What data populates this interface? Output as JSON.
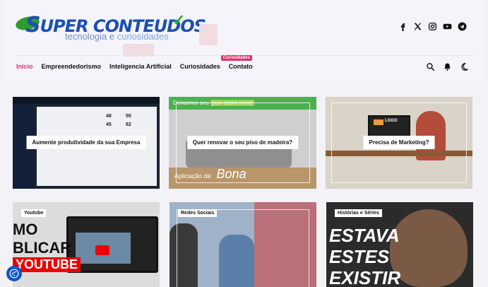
{
  "logo": {
    "main_text": "UPER CONTEUDOS",
    "s_letter": "S",
    "sub_text": "tecnologia e ",
    "sub_accent": "curiosidades"
  },
  "socials": [
    {
      "icon": "facebook-icon"
    },
    {
      "icon": "x-icon"
    },
    {
      "icon": "instagram-icon"
    },
    {
      "icon": "youtube-icon"
    },
    {
      "icon": "telegram-icon"
    }
  ],
  "nav": {
    "items": [
      {
        "label": "Início",
        "active": true
      },
      {
        "label": "Empreendedorismo"
      },
      {
        "label": "Inteligencia Artificial"
      },
      {
        "label": "Curiosidades"
      },
      {
        "label": "Contato"
      }
    ],
    "badge": "Curiosidades"
  },
  "tools": [
    "search-icon",
    "bell-icon",
    "moon-icon"
  ],
  "cards_row1": [
    {
      "label": "Aumente produtividade da sua Empresa"
    },
    {
      "label": "Quer renovar o seu piso de madeira?",
      "banner_text": "Deixamos seu ",
      "banner_accent": "piso como novo!",
      "footer_small": "Aplicação de",
      "footer_big": "Bona"
    },
    {
      "label": "Precisa de Marketing?",
      "monitor_text": "LOGO"
    }
  ],
  "cards_row2": [
    {
      "tag": "Youtube",
      "overlay_line1": "MO",
      "overlay_line2": "BLICAR",
      "overlay_yt": "YOUTUBE"
    },
    {
      "tag": "Redes Sociais"
    },
    {
      "tag": "Histórias e Séries",
      "overlay_line1": "ESTAVA",
      "overlay_line2": "ESTES",
      "overlay_line3": "EXISTIR"
    }
  ],
  "dashboard": {
    "stats": [
      "48",
      "55",
      "45",
      "62"
    ]
  }
}
